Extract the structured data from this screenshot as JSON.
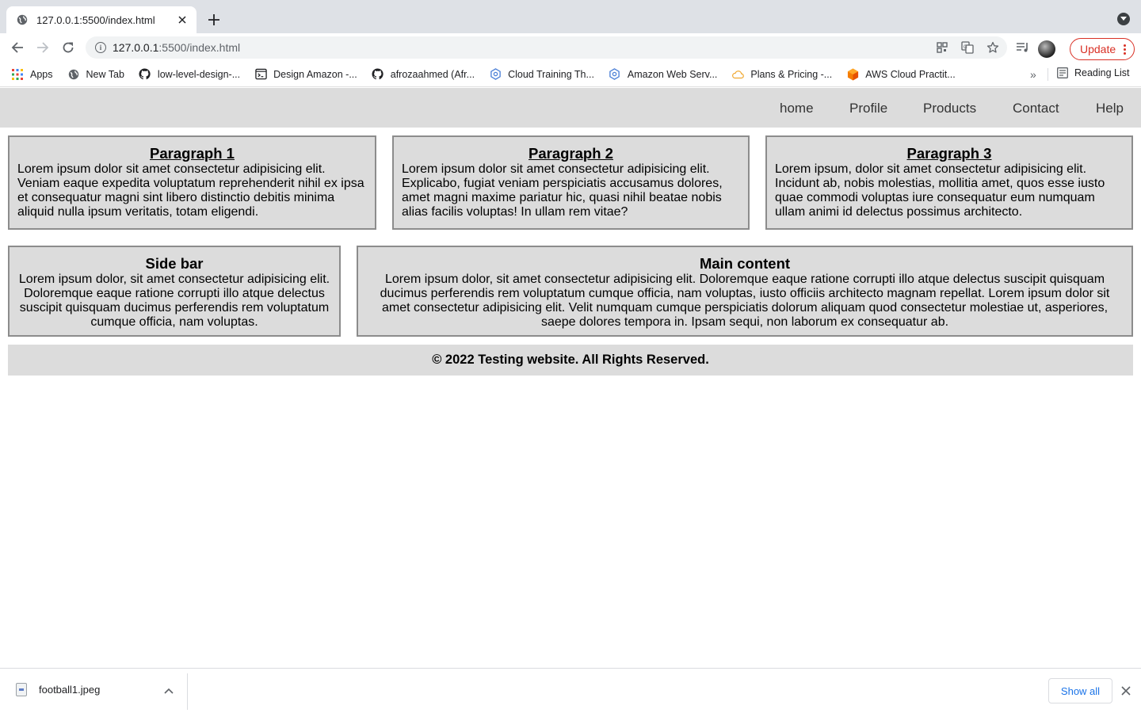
{
  "browser": {
    "tab": {
      "title": "127.0.0.1:5500/index.html"
    },
    "address": {
      "host": "127.0.0.1",
      "path": ":5500/index.html"
    },
    "update_label": "Update",
    "bookmarks": [
      {
        "label": "Apps",
        "icon": "apps-grid-icon"
      },
      {
        "label": "New Tab",
        "icon": "globe-icon"
      },
      {
        "label": "low-level-design-...",
        "icon": "github-icon"
      },
      {
        "label": "Design Amazon -...",
        "icon": "terminal-icon"
      },
      {
        "label": "afrozaahmed (Afr...",
        "icon": "github-icon"
      },
      {
        "label": "Cloud Training Th...",
        "icon": "cloud-training-icon"
      },
      {
        "label": "Amazon Web Serv...",
        "icon": "cloud-training-icon"
      },
      {
        "label": "Plans & Pricing -...",
        "icon": "cloud-icon"
      },
      {
        "label": "AWS Cloud Practit...",
        "icon": "aws-cube-icon"
      }
    ],
    "more_bookmarks": "»",
    "reading_list": "Reading List"
  },
  "page": {
    "nav": [
      "home",
      "Profile",
      "Products",
      "Contact",
      "Help"
    ],
    "paragraphs": [
      {
        "title": "Paragraph 1",
        "text": "Lorem ipsum dolor sit amet consectetur adipisicing elit. Veniam eaque expedita voluptatum reprehenderit nihil ex ipsa et consequatur magni sint libero distinctio debitis minima aliquid nulla ipsum veritatis, totam eligendi."
      },
      {
        "title": "Paragraph 2",
        "text": "Lorem ipsum dolor sit amet consectetur adipisicing elit. Explicabo, fugiat veniam perspiciatis accusamus dolores, amet magni maxime pariatur hic, quasi nihil beatae nobis alias facilis voluptas! In ullam rem vitae?"
      },
      {
        "title": "Paragraph 3",
        "text": "Lorem ipsum, dolor sit amet consectetur adipisicing elit. Incidunt ab, nobis molestias, mollitia amet, quos esse iusto quae commodi voluptas iure consequatur eum numquam ullam animi id delectus possimus architecto."
      }
    ],
    "sidebar": {
      "title": "Side bar",
      "text": "Lorem ipsum dolor, sit amet consectetur adipisicing elit. Doloremque eaque ratione corrupti illo atque delectus suscipit quisquam ducimus perferendis rem voluptatum cumque officia, nam voluptas."
    },
    "main": {
      "title": "Main content",
      "text": "Lorem ipsum dolor, sit amet consectetur adipisicing elit. Doloremque eaque ratione corrupti illo atque delectus suscipit quisquam ducimus perferendis rem voluptatum cumque officia, nam voluptas, iusto officiis architecto magnam repellat. Lorem ipsum dolor sit amet consectetur adipisicing elit. Velit numquam cumque perspiciatis dolorum aliquam quod consectetur molestiae ut, asperiores, saepe dolores tempora in. Ipsam sequi, non laborum ex consequatur ab."
    },
    "footer": "© 2022 Testing website. All Rights Reserved."
  },
  "downloads": {
    "file_name": "football1.jpeg",
    "show_all": "Show all"
  }
}
